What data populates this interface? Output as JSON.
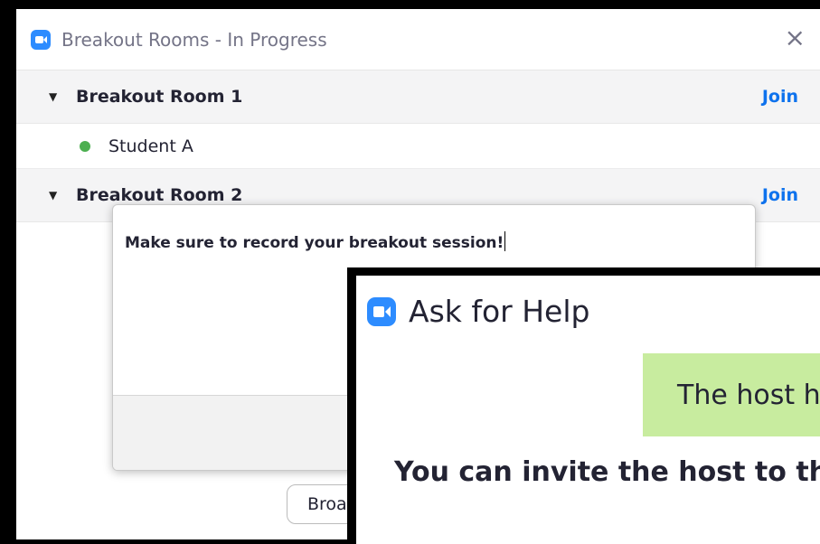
{
  "window": {
    "title": "Breakout Rooms - In Progress",
    "close_icon": "×"
  },
  "rooms": [
    {
      "name": "Breakout Room 1",
      "join_label": "Join",
      "participants": [
        "Student A"
      ]
    },
    {
      "name": "Breakout Room 2",
      "join_label": "Join",
      "participants": []
    }
  ],
  "broadcast_button": {
    "label": "Broa"
  },
  "message_dialog": {
    "text": "Make sure to record your breakout session!"
  },
  "help_window": {
    "title": "Ask for Help",
    "banner": "The host h",
    "message": "You can invite the host to th"
  },
  "colors": {
    "accent": "#0e72ed",
    "zoom_blue": "#2d8cff",
    "status_online": "#4caf50",
    "banner_green": "#c8ec9f"
  }
}
